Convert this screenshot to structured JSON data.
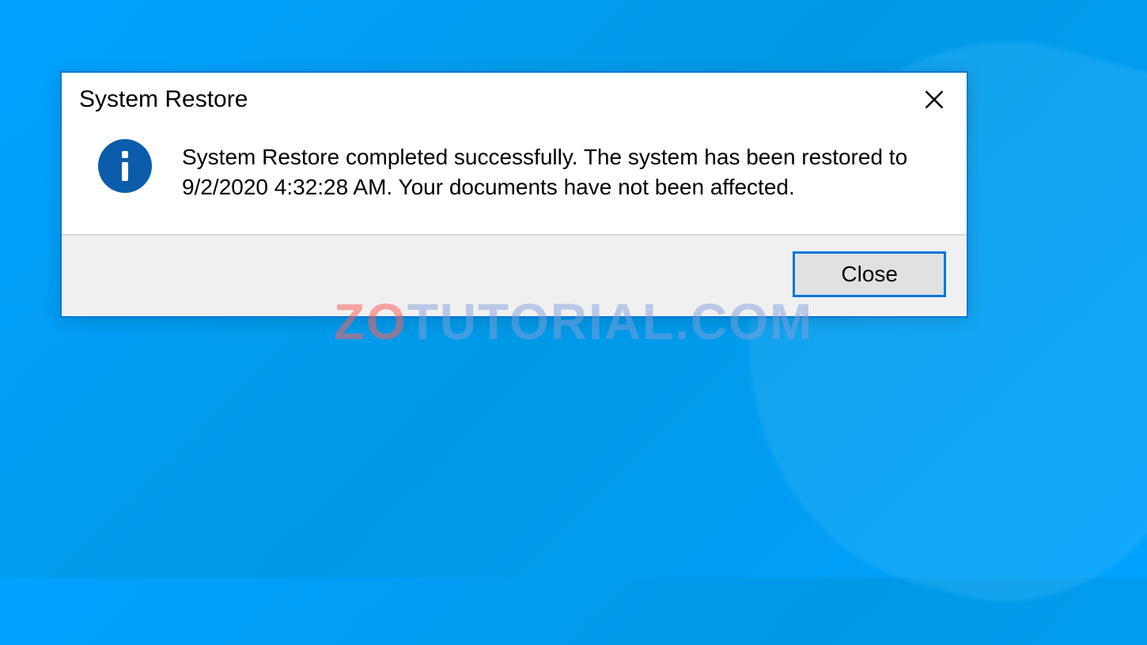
{
  "dialog": {
    "title": "System Restore",
    "message": "System Restore completed successfully. The system has been restored to 9/2/2020 4:32:28 AM. Your documents have not been affected.",
    "close_button_label": "Close"
  },
  "watermark": {
    "part1": "ZO",
    "part2": "TUTORIAL",
    "part3": ".COM"
  }
}
